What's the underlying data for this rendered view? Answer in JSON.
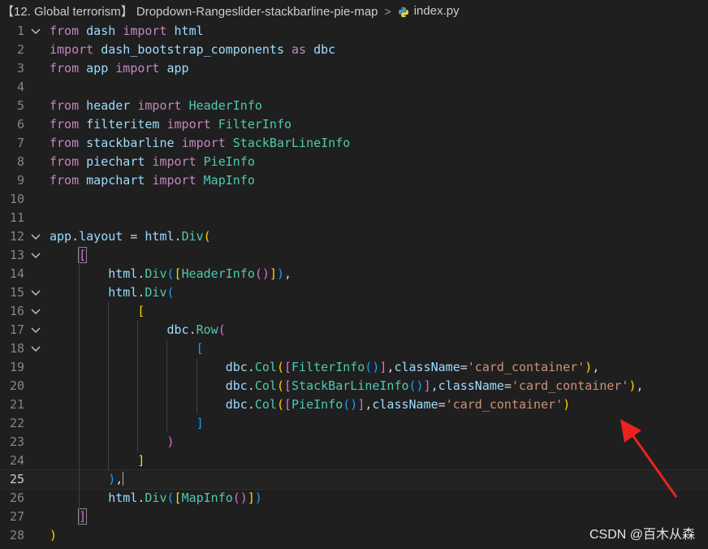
{
  "breadcrumb": {
    "folder": "【12. Global terrorism】 Dropdown-Rangeslider-stackbarline-pie-map",
    "file": "index.py",
    "python_icon": "python-icon",
    "separator_icon": "chevron-right-icon"
  },
  "editor": {
    "current_line": 25,
    "fold_icon": "chevron-down-icon",
    "foldable_lines": [
      1,
      12,
      13,
      15,
      16,
      17,
      18
    ],
    "lines": [
      {
        "n": "1",
        "tokens": [
          [
            "kw",
            "from"
          ],
          [
            "op",
            " "
          ],
          [
            "id",
            "dash"
          ],
          [
            "op",
            " "
          ],
          [
            "kw",
            "import"
          ],
          [
            "op",
            " "
          ],
          [
            "id",
            "html"
          ]
        ]
      },
      {
        "n": "2",
        "tokens": [
          [
            "kw",
            "import"
          ],
          [
            "op",
            " "
          ],
          [
            "id",
            "dash_bootstrap_components"
          ],
          [
            "op",
            " "
          ],
          [
            "kw",
            "as"
          ],
          [
            "op",
            " "
          ],
          [
            "id",
            "dbc"
          ]
        ]
      },
      {
        "n": "3",
        "tokens": [
          [
            "kw",
            "from"
          ],
          [
            "op",
            " "
          ],
          [
            "id",
            "app"
          ],
          [
            "op",
            " "
          ],
          [
            "kw",
            "import"
          ],
          [
            "op",
            " "
          ],
          [
            "id",
            "app"
          ]
        ]
      },
      {
        "n": "4",
        "tokens": []
      },
      {
        "n": "5",
        "tokens": [
          [
            "kw",
            "from"
          ],
          [
            "op",
            " "
          ],
          [
            "id",
            "header"
          ],
          [
            "op",
            " "
          ],
          [
            "kw",
            "import"
          ],
          [
            "op",
            " "
          ],
          [
            "cls",
            "HeaderInfo"
          ]
        ]
      },
      {
        "n": "6",
        "tokens": [
          [
            "kw",
            "from"
          ],
          [
            "op",
            " "
          ],
          [
            "id",
            "filteritem"
          ],
          [
            "op",
            " "
          ],
          [
            "kw",
            "import"
          ],
          [
            "op",
            " "
          ],
          [
            "cls",
            "FilterInfo"
          ]
        ]
      },
      {
        "n": "7",
        "tokens": [
          [
            "kw",
            "from"
          ],
          [
            "op",
            " "
          ],
          [
            "id",
            "stackbarline"
          ],
          [
            "op",
            " "
          ],
          [
            "kw",
            "import"
          ],
          [
            "op",
            " "
          ],
          [
            "cls",
            "StackBarLineInfo"
          ]
        ]
      },
      {
        "n": "8",
        "tokens": [
          [
            "kw",
            "from"
          ],
          [
            "op",
            " "
          ],
          [
            "id",
            "piechart"
          ],
          [
            "op",
            " "
          ],
          [
            "kw",
            "import"
          ],
          [
            "op",
            " "
          ],
          [
            "cls",
            "PieInfo"
          ]
        ]
      },
      {
        "n": "9",
        "tokens": [
          [
            "kw",
            "from"
          ],
          [
            "op",
            " "
          ],
          [
            "id",
            "mapchart"
          ],
          [
            "op",
            " "
          ],
          [
            "kw",
            "import"
          ],
          [
            "op",
            " "
          ],
          [
            "cls",
            "MapInfo"
          ]
        ]
      },
      {
        "n": "10",
        "tokens": []
      },
      {
        "n": "11",
        "tokens": []
      },
      {
        "n": "12",
        "tokens": [
          [
            "id",
            "app"
          ],
          [
            "op",
            "."
          ],
          [
            "id",
            "layout"
          ],
          [
            "op",
            " = "
          ],
          [
            "id",
            "html"
          ],
          [
            "op",
            "."
          ],
          [
            "cls",
            "Div"
          ],
          [
            "b1",
            "("
          ]
        ]
      },
      {
        "n": "13",
        "tokens": [
          [
            "op",
            "    "
          ],
          [
            "b2box",
            "["
          ]
        ]
      },
      {
        "n": "14",
        "tokens": [
          [
            "op",
            "        "
          ],
          [
            "id",
            "html"
          ],
          [
            "op",
            "."
          ],
          [
            "cls",
            "Div"
          ],
          [
            "b3",
            "("
          ],
          [
            "b1",
            "["
          ],
          [
            "cls",
            "HeaderInfo"
          ],
          [
            "b2",
            "()"
          ],
          [
            "b1",
            "]"
          ],
          [
            "b3",
            ")"
          ],
          [
            "op",
            ","
          ]
        ]
      },
      {
        "n": "15",
        "tokens": [
          [
            "op",
            "        "
          ],
          [
            "id",
            "html"
          ],
          [
            "op",
            "."
          ],
          [
            "cls",
            "Div"
          ],
          [
            "b3",
            "("
          ]
        ]
      },
      {
        "n": "16",
        "tokens": [
          [
            "op",
            "            "
          ],
          [
            "b1",
            "["
          ]
        ]
      },
      {
        "n": "17",
        "tokens": [
          [
            "op",
            "                "
          ],
          [
            "id",
            "dbc"
          ],
          [
            "op",
            "."
          ],
          [
            "cls",
            "Row"
          ],
          [
            "b2",
            "("
          ]
        ]
      },
      {
        "n": "18",
        "tokens": [
          [
            "op",
            "                    "
          ],
          [
            "b3",
            "["
          ]
        ]
      },
      {
        "n": "19",
        "tokens": [
          [
            "op",
            "                        "
          ],
          [
            "id",
            "dbc"
          ],
          [
            "op",
            "."
          ],
          [
            "cls",
            "Col"
          ],
          [
            "b1",
            "("
          ],
          [
            "b2",
            "["
          ],
          [
            "cls",
            "FilterInfo"
          ],
          [
            "b3",
            "()"
          ],
          [
            "b2",
            "]"
          ],
          [
            "op",
            ","
          ],
          [
            "id",
            "className"
          ],
          [
            "op",
            "="
          ],
          [
            "str",
            "'card_container'"
          ],
          [
            "b1",
            ")"
          ],
          [
            "op",
            ","
          ]
        ]
      },
      {
        "n": "20",
        "tokens": [
          [
            "op",
            "                        "
          ],
          [
            "id",
            "dbc"
          ],
          [
            "op",
            "."
          ],
          [
            "cls",
            "Col"
          ],
          [
            "b1",
            "("
          ],
          [
            "b2",
            "["
          ],
          [
            "cls",
            "StackBarLineInfo"
          ],
          [
            "b3",
            "()"
          ],
          [
            "b2",
            "]"
          ],
          [
            "op",
            ","
          ],
          [
            "id",
            "className"
          ],
          [
            "op",
            "="
          ],
          [
            "str",
            "'card_container'"
          ],
          [
            "b1",
            ")"
          ],
          [
            "op",
            ","
          ]
        ]
      },
      {
        "n": "21",
        "tokens": [
          [
            "op",
            "                        "
          ],
          [
            "id",
            "dbc"
          ],
          [
            "op",
            "."
          ],
          [
            "cls",
            "Col"
          ],
          [
            "b1",
            "("
          ],
          [
            "b2",
            "["
          ],
          [
            "cls",
            "PieInfo"
          ],
          [
            "b3",
            "()"
          ],
          [
            "b2",
            "]"
          ],
          [
            "op",
            ","
          ],
          [
            "id",
            "className"
          ],
          [
            "op",
            "="
          ],
          [
            "str",
            "'card_container'"
          ],
          [
            "b1",
            ")"
          ]
        ]
      },
      {
        "n": "22",
        "tokens": [
          [
            "op",
            "                    "
          ],
          [
            "b3",
            "]"
          ]
        ]
      },
      {
        "n": "23",
        "tokens": [
          [
            "op",
            "                "
          ],
          [
            "b2",
            ")"
          ]
        ]
      },
      {
        "n": "24",
        "tokens": [
          [
            "op",
            "            "
          ],
          [
            "b1",
            "]"
          ]
        ]
      },
      {
        "n": "25",
        "tokens": [
          [
            "op",
            "        "
          ],
          [
            "b3",
            ")"
          ],
          [
            "op",
            ","
          ],
          [
            "cursor",
            ""
          ]
        ]
      },
      {
        "n": "26",
        "tokens": [
          [
            "op",
            "        "
          ],
          [
            "id",
            "html"
          ],
          [
            "op",
            "."
          ],
          [
            "cls",
            "Div"
          ],
          [
            "b3",
            "("
          ],
          [
            "b1",
            "["
          ],
          [
            "cls",
            "MapInfo"
          ],
          [
            "b2",
            "()"
          ],
          [
            "b1",
            "]"
          ],
          [
            "b3",
            ")"
          ]
        ]
      },
      {
        "n": "27",
        "tokens": [
          [
            "op",
            "    "
          ],
          [
            "b2box",
            "]"
          ]
        ]
      },
      {
        "n": "28",
        "tokens": [
          [
            "b1",
            ")"
          ]
        ]
      }
    ]
  },
  "annotation": {
    "arrow_color": "#e8231f"
  },
  "watermark": "CSDN @百木从森",
  "colors": {
    "background": "#1f1f1f",
    "keyword": "#c586c0",
    "variable": "#9cdcfe",
    "class": "#4ec9b0",
    "string": "#ce9178",
    "bracket_level1": "#ffd700",
    "bracket_level2": "#da70d6",
    "bracket_level3": "#179fff"
  }
}
